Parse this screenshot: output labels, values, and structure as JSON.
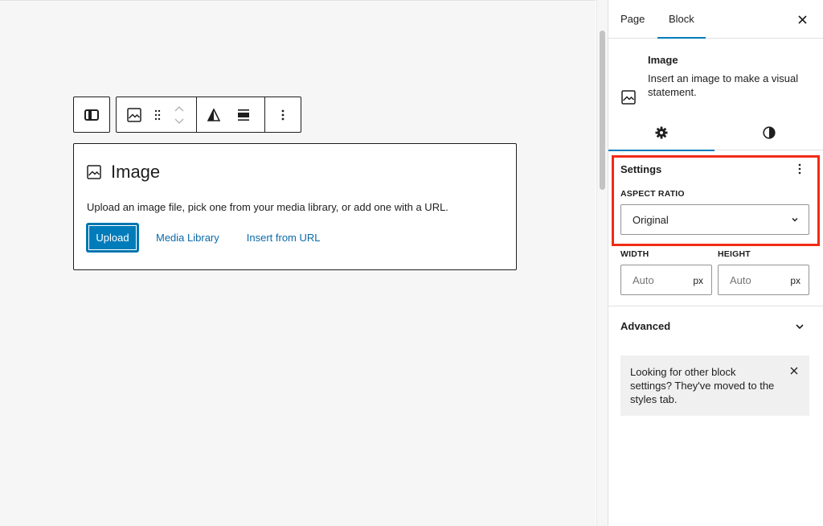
{
  "toolbar": {
    "items": [
      "block-type-icon",
      "drag-handle-icon",
      "move-up-icon",
      "move-down-icon",
      "duotone-icon",
      "align-icon",
      "more-options-icon"
    ]
  },
  "placeholder": {
    "title": "Image",
    "description": "Upload an image file, pick one from your media library, or add one with a URL.",
    "upload_label": "Upload",
    "media_library_label": "Media Library",
    "insert_url_label": "Insert from URL"
  },
  "sidebar": {
    "tabs": {
      "page": "Page",
      "block": "Block"
    },
    "block_card": {
      "title": "Image",
      "description": "Insert an image to make a visual statement."
    },
    "settings": {
      "title": "Settings",
      "aspect_ratio_label": "ASPECT RATIO",
      "aspect_ratio_value": "Original",
      "width_label": "WIDTH",
      "height_label": "HEIGHT",
      "width_placeholder": "Auto",
      "height_placeholder": "Auto",
      "unit": "px"
    },
    "advanced": {
      "title": "Advanced"
    },
    "notice": {
      "text": "Looking for other block settings? They've moved to the styles tab."
    }
  },
  "colors": {
    "accent": "#007cba",
    "highlight": "#f22b14",
    "canvas_bg": "#f6f6f6"
  }
}
